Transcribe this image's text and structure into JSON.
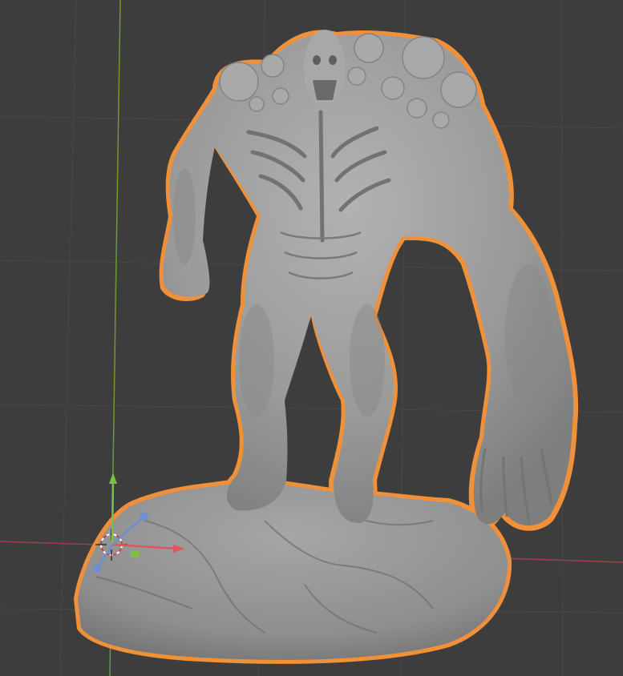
{
  "viewport": {
    "background": "#3d3d3d",
    "grid_color": "#4a4a4a",
    "x_axis_color": "#a33d4a",
    "y_axis_color": "#6f9a2a",
    "selection_outline_color": "#f0913a",
    "mesh_color": "#9c9c9c"
  },
  "scene": {
    "selected_object": "sculpted-creature-on-rock",
    "selected": true
  },
  "gizmo": {
    "icons": [
      "3d-cursor-icon",
      "move-gizmo-icon"
    ]
  }
}
